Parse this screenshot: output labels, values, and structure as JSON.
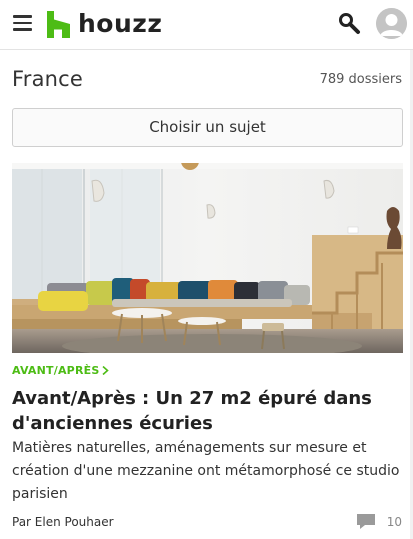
{
  "header": {
    "logo_text": "houzz",
    "brand_color": "#4dbc15",
    "menu_icon": "hamburger-menu-icon",
    "search_icon": "search-icon",
    "profile_icon": "user-avatar-icon"
  },
  "section": {
    "title": "France",
    "count": "789 dossiers"
  },
  "choose_topic": {
    "label": "Choisir un sujet"
  },
  "article": {
    "category": "AVANT/APRÈS",
    "category_color": "#4dbc15",
    "title": "Avant/Après : Un 27 m2 épuré dans d'anciennes écuries",
    "summary": "Matières naturelles, aménagements sur mesure et création d'une mezzanine ont métamorphosé ce studio parisien",
    "author": "Par Elen Pouhaer",
    "comment_count": "10",
    "comment_icon": "comment-bubble-icon"
  }
}
